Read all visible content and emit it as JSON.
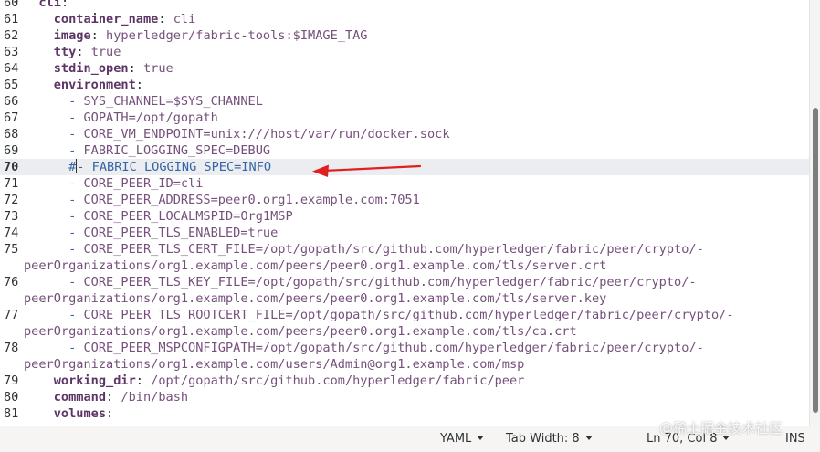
{
  "editor": {
    "lines": [
      {
        "num": "60",
        "segs": [
          [
            "indent",
            "  "
          ],
          [
            "key",
            "cli"
          ],
          [
            "plain",
            ":"
          ]
        ]
      },
      {
        "num": "61",
        "segs": [
          [
            "indent",
            "    "
          ],
          [
            "key",
            "container_name"
          ],
          [
            "plain",
            ": "
          ],
          [
            "val",
            "cli"
          ]
        ]
      },
      {
        "num": "62",
        "segs": [
          [
            "indent",
            "    "
          ],
          [
            "key",
            "image"
          ],
          [
            "plain",
            ": "
          ],
          [
            "val",
            "hyperledger/fabric-tools:$IMAGE_TAG"
          ]
        ]
      },
      {
        "num": "63",
        "segs": [
          [
            "indent",
            "    "
          ],
          [
            "key",
            "tty"
          ],
          [
            "plain",
            ": "
          ],
          [
            "val",
            "true"
          ]
        ]
      },
      {
        "num": "64",
        "segs": [
          [
            "indent",
            "    "
          ],
          [
            "key",
            "stdin_open"
          ],
          [
            "plain",
            ": "
          ],
          [
            "val",
            "true"
          ]
        ]
      },
      {
        "num": "65",
        "segs": [
          [
            "indent",
            "    "
          ],
          [
            "key",
            "environment"
          ],
          [
            "plain",
            ":"
          ]
        ]
      },
      {
        "num": "66",
        "segs": [
          [
            "indent",
            "      "
          ],
          [
            "dash",
            "- "
          ],
          [
            "item",
            "SYS_CHANNEL=$SYS_CHANNEL"
          ]
        ]
      },
      {
        "num": "67",
        "segs": [
          [
            "indent",
            "      "
          ],
          [
            "dash",
            "- "
          ],
          [
            "item",
            "GOPATH=/opt/gopath"
          ]
        ]
      },
      {
        "num": "68",
        "segs": [
          [
            "indent",
            "      "
          ],
          [
            "dash",
            "- "
          ],
          [
            "item",
            "CORE_VM_ENDPOINT=unix:///host/var/run/docker.sock"
          ]
        ]
      },
      {
        "num": "69",
        "segs": [
          [
            "indent",
            "      "
          ],
          [
            "dash",
            "- "
          ],
          [
            "item",
            "FABRIC_LOGGING_SPEC=DEBUG"
          ]
        ]
      },
      {
        "num": "70",
        "current": true,
        "segs": [
          [
            "indent",
            "      "
          ],
          [
            "hash",
            "#"
          ],
          [
            "caret",
            ""
          ],
          [
            "dash",
            "- "
          ],
          [
            "hash",
            "FABRIC_LOGGING_SPEC=INFO"
          ]
        ]
      },
      {
        "num": "71",
        "segs": [
          [
            "indent",
            "      "
          ],
          [
            "dash",
            "- "
          ],
          [
            "item",
            "CORE_PEER_ID=cli"
          ]
        ]
      },
      {
        "num": "72",
        "segs": [
          [
            "indent",
            "      "
          ],
          [
            "dash",
            "- "
          ],
          [
            "item",
            "CORE_PEER_ADDRESS=peer0.org1.example.com:7051"
          ]
        ]
      },
      {
        "num": "73",
        "segs": [
          [
            "indent",
            "      "
          ],
          [
            "dash",
            "- "
          ],
          [
            "item",
            "CORE_PEER_LOCALMSPID=Org1MSP"
          ]
        ]
      },
      {
        "num": "74",
        "segs": [
          [
            "indent",
            "      "
          ],
          [
            "dash",
            "- "
          ],
          [
            "item",
            "CORE_PEER_TLS_ENABLED=true"
          ]
        ]
      },
      {
        "num": "75",
        "segs": [
          [
            "indent",
            "      "
          ],
          [
            "dash",
            "- "
          ],
          [
            "item",
            "CORE_PEER_TLS_CERT_FILE=/opt/gopath/src/github.com/hyperledger/fabric/peer/crypto/-"
          ]
        ]
      },
      {
        "num": "",
        "segs": [
          [
            "wrap",
            "peerOrganizations/org1.example.com/peers/peer0.org1.example.com/tls/server.crt"
          ]
        ]
      },
      {
        "num": "76",
        "segs": [
          [
            "indent",
            "      "
          ],
          [
            "dash",
            "- "
          ],
          [
            "item",
            "CORE_PEER_TLS_KEY_FILE=/opt/gopath/src/github.com/hyperledger/fabric/peer/crypto/-"
          ]
        ]
      },
      {
        "num": "",
        "segs": [
          [
            "wrap",
            "peerOrganizations/org1.example.com/peers/peer0.org1.example.com/tls/server.key"
          ]
        ]
      },
      {
        "num": "77",
        "segs": [
          [
            "indent",
            "      "
          ],
          [
            "dash",
            "- "
          ],
          [
            "item",
            "CORE_PEER_TLS_ROOTCERT_FILE=/opt/gopath/src/github.com/hyperledger/fabric/peer/crypto/-"
          ]
        ]
      },
      {
        "num": "",
        "segs": [
          [
            "wrap",
            "peerOrganizations/org1.example.com/peers/peer0.org1.example.com/tls/ca.crt"
          ]
        ]
      },
      {
        "num": "78",
        "segs": [
          [
            "indent",
            "      "
          ],
          [
            "dash",
            "- "
          ],
          [
            "item",
            "CORE_PEER_MSPCONFIGPATH=/opt/gopath/src/github.com/hyperledger/fabric/peer/crypto/-"
          ]
        ]
      },
      {
        "num": "",
        "segs": [
          [
            "wrap",
            "peerOrganizations/org1.example.com/users/Admin@org1.example.com/msp"
          ]
        ]
      },
      {
        "num": "79",
        "segs": [
          [
            "indent",
            "    "
          ],
          [
            "key",
            "working_dir"
          ],
          [
            "plain",
            ": "
          ],
          [
            "val",
            "/opt/gopath/src/github.com/hyperledger/fabric/peer"
          ]
        ]
      },
      {
        "num": "80",
        "segs": [
          [
            "indent",
            "    "
          ],
          [
            "key",
            "command"
          ],
          [
            "plain",
            ": "
          ],
          [
            "val",
            "/bin/bash"
          ]
        ]
      },
      {
        "num": "81",
        "segs": [
          [
            "indent",
            "    "
          ],
          [
            "key",
            "volumes"
          ],
          [
            "plain",
            ":"
          ]
        ]
      }
    ]
  },
  "statusbar": {
    "language": "YAML",
    "tab_width": "Tab Width: 8",
    "cursor_position": "Ln 70, Col 8",
    "insert_mode": "INS"
  },
  "watermark": "@稀土掘金技术社区",
  "colors": {
    "annotation_arrow": "#e02020",
    "current_line_bg": "#ecedf0",
    "yaml_key": "#5c3566",
    "yaml_value": "#75507b",
    "list_dash": "#3465a4"
  }
}
